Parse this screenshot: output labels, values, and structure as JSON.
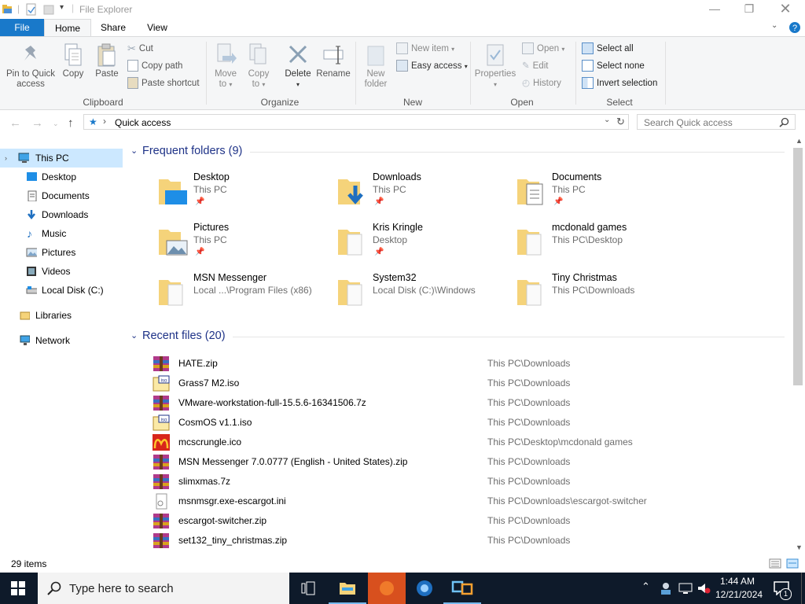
{
  "window": {
    "title": "File Explorer"
  },
  "ribbon_tabs": [
    "File",
    "Home",
    "Share",
    "View"
  ],
  "ribbon": {
    "clipboard": {
      "pin_label_1": "Pin to Quick",
      "pin_label_2": "access",
      "copy": "Copy",
      "paste": "Paste",
      "cut": "Cut",
      "copy_path": "Copy path",
      "paste_shortcut": "Paste shortcut",
      "group": "Clipboard"
    },
    "organize": {
      "move_to_1": "Move",
      "move_to_2": "to",
      "copy_to_1": "Copy",
      "copy_to_2": "to",
      "delete": "Delete",
      "rename": "Rename",
      "group": "Organize"
    },
    "new": {
      "new_folder_1": "New",
      "new_folder_2": "folder",
      "new_item": "New item",
      "easy_access": "Easy access",
      "group": "New"
    },
    "open": {
      "properties": "Properties",
      "open": "Open",
      "edit": "Edit",
      "history": "History",
      "group": "Open"
    },
    "select": {
      "select_all": "Select all",
      "select_none": "Select none",
      "invert": "Invert selection",
      "group": "Select"
    }
  },
  "address": {
    "path": "Quick access",
    "search_placeholder": "Search Quick access"
  },
  "sidebar": {
    "items": [
      {
        "label": "This PC",
        "icon": "pc-icon"
      },
      {
        "label": "Desktop",
        "icon": "desktop-icon"
      },
      {
        "label": "Documents",
        "icon": "documents-icon"
      },
      {
        "label": "Downloads",
        "icon": "downloads-icon"
      },
      {
        "label": "Music",
        "icon": "music-icon"
      },
      {
        "label": "Pictures",
        "icon": "pictures-icon"
      },
      {
        "label": "Videos",
        "icon": "videos-icon"
      },
      {
        "label": "Local Disk (C:)",
        "icon": "disk-icon"
      },
      {
        "label": "Libraries",
        "icon": "libraries-icon"
      },
      {
        "label": "Network",
        "icon": "network-icon"
      }
    ]
  },
  "frequent": {
    "header": "Frequent folders (9)",
    "folders": [
      {
        "name": "Desktop",
        "location": "This PC",
        "pinned": true
      },
      {
        "name": "Downloads",
        "location": "This PC",
        "pinned": true
      },
      {
        "name": "Documents",
        "location": "This PC",
        "pinned": true
      },
      {
        "name": "Pictures",
        "location": "This PC",
        "pinned": true
      },
      {
        "name": "Kris Kringle",
        "location": "Desktop",
        "pinned": true
      },
      {
        "name": "mcdonald games",
        "location": "This PC\\Desktop",
        "pinned": false
      },
      {
        "name": "MSN Messenger",
        "location": "Local ...\\Program Files (x86)",
        "pinned": false
      },
      {
        "name": "System32",
        "location": "Local Disk (C:)\\Windows",
        "pinned": false
      },
      {
        "name": "Tiny Christmas",
        "location": "This PC\\Downloads",
        "pinned": false
      }
    ]
  },
  "recent": {
    "header": "Recent files (20)",
    "files": [
      {
        "name": "HATE.zip",
        "path": "This PC\\Downloads",
        "icon": "archive-icon"
      },
      {
        "name": "Grass7 M2.iso",
        "path": "This PC\\Downloads",
        "icon": "iso-icon"
      },
      {
        "name": "VMware-workstation-full-15.5.6-16341506.7z",
        "path": "This PC\\Downloads",
        "icon": "archive-icon"
      },
      {
        "name": "CosmOS v1.1.iso",
        "path": "This PC\\Downloads",
        "icon": "iso-icon"
      },
      {
        "name": "mcscrungle.ico",
        "path": "This PC\\Desktop\\mcdonald games",
        "icon": "mcdonalds-icon"
      },
      {
        "name": "MSN Messenger 7.0.0777 (English - United States).zip",
        "path": "This PC\\Downloads",
        "icon": "archive-icon"
      },
      {
        "name": "slimxmas.7z",
        "path": "This PC\\Downloads",
        "icon": "archive-icon"
      },
      {
        "name": "msnmsgr.exe-escargot.ini",
        "path": "This PC\\Downloads\\escargot-switcher",
        "icon": "ini-file-icon"
      },
      {
        "name": "escargot-switcher.zip",
        "path": "This PC\\Downloads",
        "icon": "archive-icon"
      },
      {
        "name": "set132_tiny_christmas.zip",
        "path": "This PC\\Downloads",
        "icon": "archive-icon"
      }
    ]
  },
  "status": {
    "items": "29 items"
  },
  "taskbar": {
    "search_placeholder": "Type here to search",
    "time": "1:44 AM",
    "date": "12/21/2024",
    "notification_count": "1"
  },
  "colors": {
    "accent": "#1979ca",
    "section_header": "#1e3287",
    "taskbar": "#0e1a2a",
    "folder": "#f5d37a"
  }
}
